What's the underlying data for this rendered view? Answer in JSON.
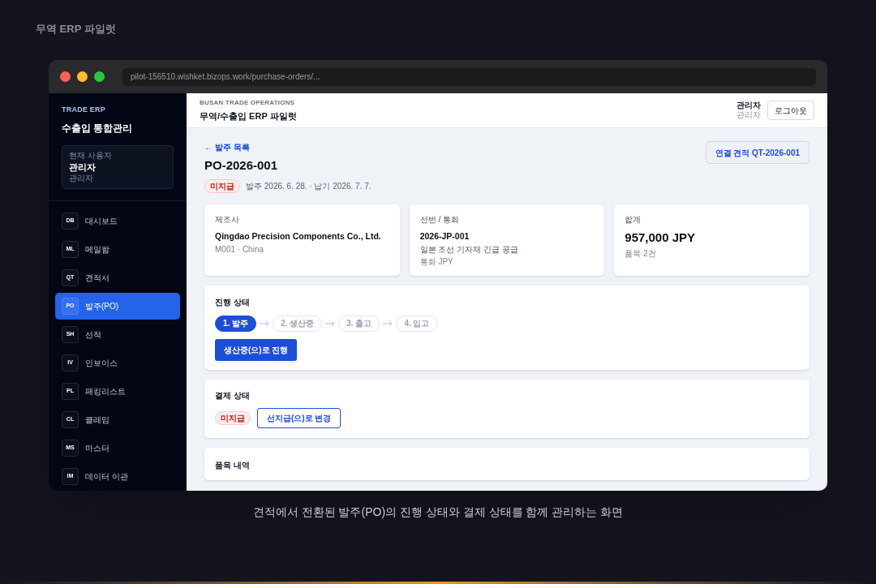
{
  "showcase_title": "무역 ERP 파일럿",
  "browser": {
    "url": "pilot-156510.wishket.bizops.work/purchase-orders/..."
  },
  "sidebar": {
    "brand": "TRADE ERP",
    "subtitle": "수출입 통합관리",
    "user_card": {
      "label": "현재 사용자",
      "name": "관리자",
      "role": "관리자"
    },
    "items": [
      {
        "code": "DB",
        "label": "대시보드",
        "selected": false
      },
      {
        "code": "ML",
        "label": "메일함",
        "selected": false
      },
      {
        "code": "QT",
        "label": "견적서",
        "selected": false
      },
      {
        "code": "PO",
        "label": "발주(PO)",
        "selected": true
      },
      {
        "code": "SH",
        "label": "선적",
        "selected": false
      },
      {
        "code": "IV",
        "label": "인보이스",
        "selected": false
      },
      {
        "code": "PL",
        "label": "패킹리스트",
        "selected": false
      },
      {
        "code": "CL",
        "label": "클레임",
        "selected": false
      },
      {
        "code": "MS",
        "label": "마스터",
        "selected": false
      },
      {
        "code": "IM",
        "label": "데이터 이관",
        "selected": false
      }
    ]
  },
  "header": {
    "org": "BUSAN TRADE OPERATIONS",
    "title": "무역/수출입 ERP 파일럿",
    "user_name": "관리자",
    "user_role": "관리자",
    "logout": "로그아웃"
  },
  "page": {
    "back_link": "← 발주 목록",
    "title": "PO-2026-001",
    "payment_badge": "미지급",
    "dates": "발주 2026. 6. 28. · 납기 2026. 7. 7.",
    "linked_quote": "연결 견적 QT-2026-001"
  },
  "cards": [
    {
      "label": "제조사",
      "value": "Qingdao Precision Components Co., Ltd.",
      "kind": "normal",
      "lines": [
        "M001 · China"
      ]
    },
    {
      "label": "선번 / 통화",
      "value": "2026-JP-001",
      "kind": "normal",
      "lines": [
        "일본 조선 기자재 긴급 공급",
        "통화 JPY"
      ]
    },
    {
      "label": "합계",
      "value": "957,000 JPY",
      "kind": "large",
      "lines": [
        "품목 2건"
      ]
    }
  ],
  "progress": {
    "title": "진행 상태",
    "steps": [
      {
        "label": "1. 발주",
        "selected": true
      },
      {
        "label": "2. 생산중",
        "selected": false
      },
      {
        "label": "3. 출고",
        "selected": false
      },
      {
        "label": "4. 입고",
        "selected": false
      }
    ],
    "action": "생산중(으)로 진행"
  },
  "payment": {
    "title": "결제 상태",
    "badge": "미지급",
    "action": "선지급(으)로 변경"
  },
  "items_section": {
    "title": "품목 내역"
  },
  "caption": "견적에서 전환된 발주(PO)의 진행 상태와 결제 상태를 함께 관리하는 화면"
}
